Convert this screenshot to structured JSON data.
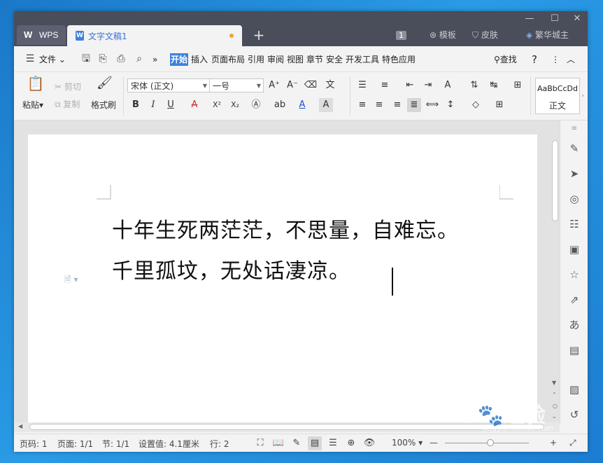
{
  "window": {
    "app_tab_label": "WPS",
    "doc_tab_label": "文字文稿1",
    "new_tab": "+",
    "badge": "1",
    "template_label": "模板",
    "skin_label": "皮肤",
    "user_label": "繁华城主",
    "controls": {
      "minimize": "—",
      "maximize": "☐",
      "close": "✕"
    }
  },
  "menubar": {
    "file_label": "文件",
    "more": "»",
    "tabs": [
      "开始",
      "插入",
      "页面布局",
      "引用",
      "审阅",
      "视图",
      "章节",
      "安全",
      "开发工具",
      "特色应用"
    ],
    "active_tab": "开始",
    "search_label": "查找",
    "help": "?",
    "more_menu": "⋮"
  },
  "ribbon": {
    "paste_label": "粘贴",
    "cut_label": "剪切",
    "copy_label": "复制",
    "format_painter_label": "格式刷",
    "font_name": "宋体 (正文)",
    "font_size": "一号",
    "bold": "B",
    "italic": "I",
    "underline": "U",
    "superscript": "X²",
    "subscript": "X₂",
    "style_preview": "AaBbCcDd",
    "style_name": "正文"
  },
  "document": {
    "lines": [
      "十年生死两茫茫，不思量，自难忘。",
      "千里孤坟，无处话凄凉。"
    ]
  },
  "status": {
    "page_number": "页码: 1",
    "page_count": "页面: 1/1",
    "section": "节: 1/1",
    "position": "设置值: 4.1厘米",
    "row": "行: 2",
    "zoom": "100%"
  },
  "watermark": {
    "brand": "Bai",
    "brand_end": "经验",
    "url": "jingyan.baidu.com"
  }
}
